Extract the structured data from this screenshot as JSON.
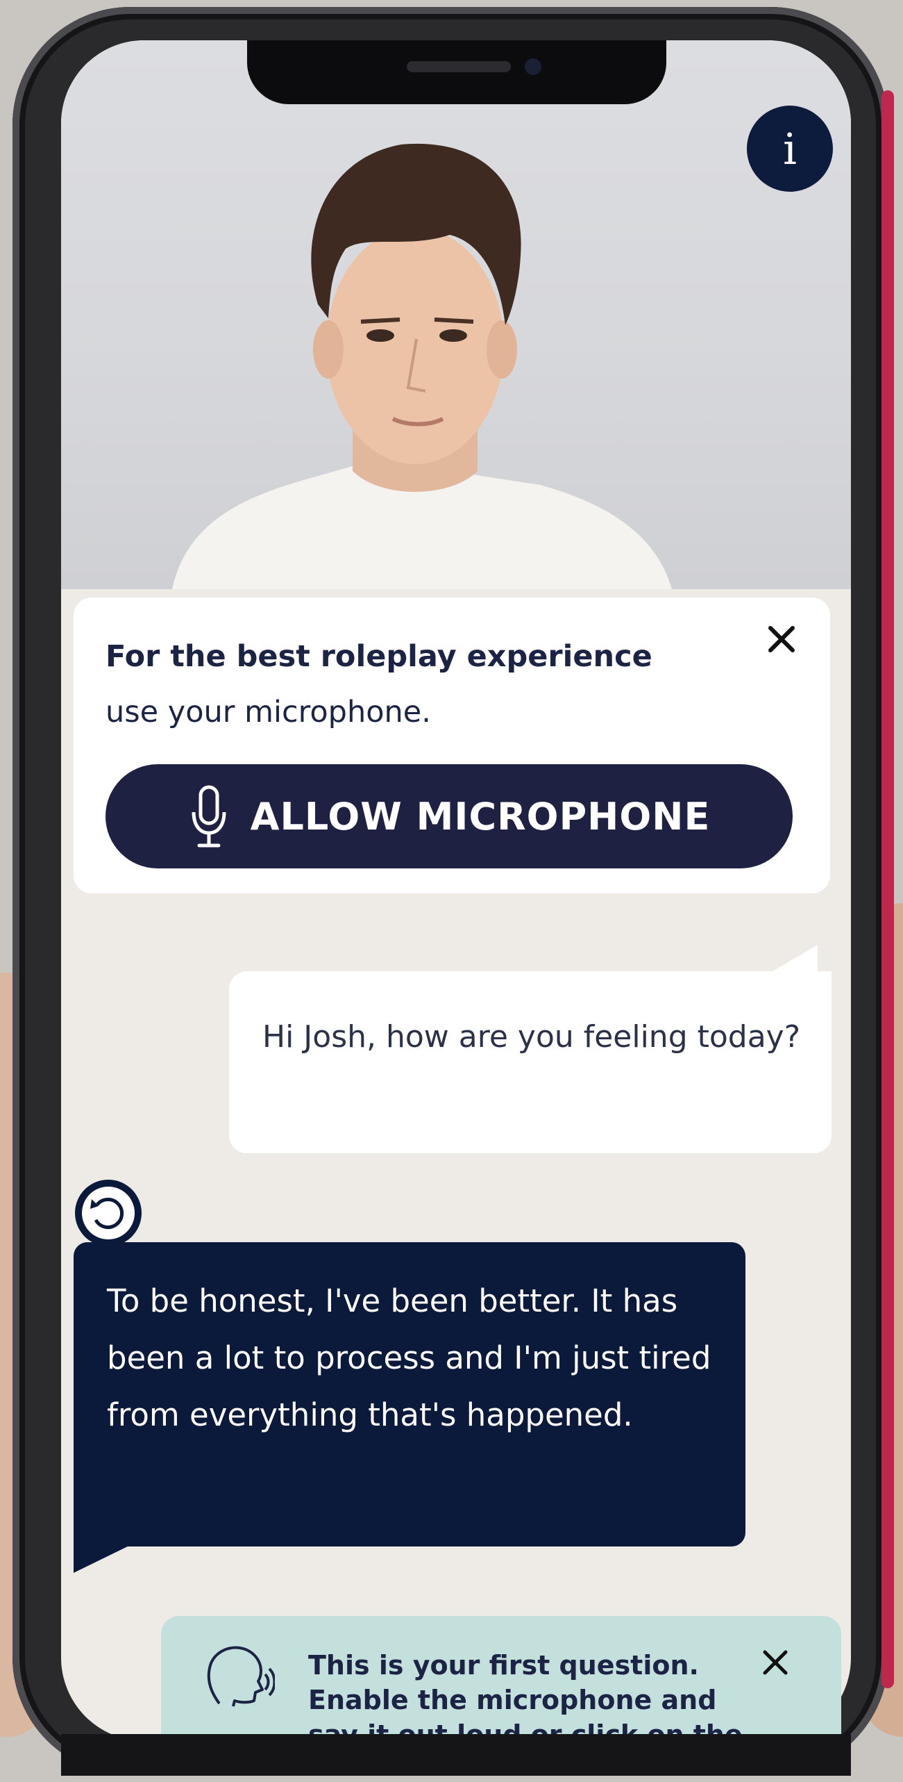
{
  "info_button": {
    "label": "i"
  },
  "mic_prompt": {
    "title": "For the best roleplay experience",
    "subtitle": "use your microphone.",
    "allow_button": "ALLOW MICROPHONE"
  },
  "conversation": {
    "user_message": "Hi Josh, how are you feeling today?",
    "bot_message": "To be honest, I've been better. It has been a lot to process and I'm just tired from everything that's happened."
  },
  "hint": {
    "text": "This is your first question. Enable the microphone and say it out loud or click on the"
  },
  "colors": {
    "navy": "#0b1a3b",
    "button_navy": "#1e2142",
    "hint_teal": "#c4e0dc",
    "screen_bg": "#eeebe6"
  }
}
